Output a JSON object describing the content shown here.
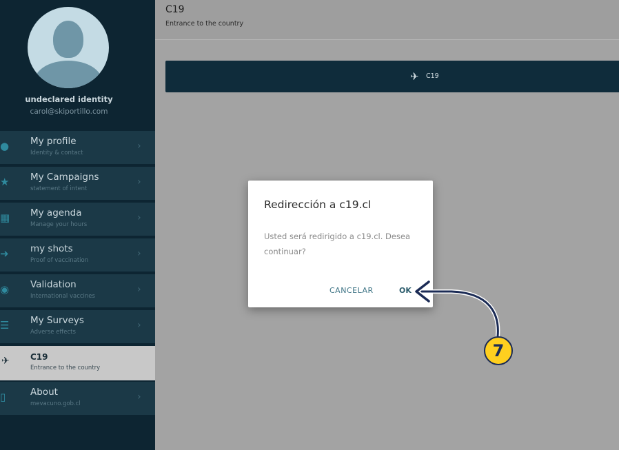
{
  "sidebar": {
    "user": {
      "name": "undeclared identity",
      "email": "carol@skiportillo.com"
    },
    "items": [
      {
        "title": "My profile",
        "subtitle": "Identity & contact",
        "icon": "person-icon"
      },
      {
        "title": "My Campaigns",
        "subtitle": "statement of intent",
        "icon": "star-icon"
      },
      {
        "title": "My agenda",
        "subtitle": "Manage your hours",
        "icon": "calendar-icon"
      },
      {
        "title": "my shots",
        "subtitle": "Proof of vaccination",
        "icon": "syringe-icon"
      },
      {
        "title": "Validation",
        "subtitle": "International vaccines",
        "icon": "globe-icon"
      },
      {
        "title": "My Surveys",
        "subtitle": "Adverse effects",
        "icon": "list-icon"
      },
      {
        "title": "C19",
        "subtitle": "Entrance to the country",
        "icon": "plane-landing-icon",
        "active": true
      },
      {
        "title": "About",
        "subtitle": "mevacuno.gob.cl",
        "icon": "phone-icon"
      }
    ]
  },
  "header": {
    "title": "C19",
    "subtitle": "Entrance to the country"
  },
  "c19_button": {
    "label": "C19",
    "icon": "plane-landing-icon"
  },
  "dialog": {
    "title": "Redirección a c19.cl",
    "message": "Usted será redirigido a c19.cl. Desea continuar?",
    "cancel_label": "CANCELAR",
    "ok_label": "OK"
  },
  "annotation": {
    "step": "7",
    "badge_color": "#ffcf1f",
    "arrow_color": "#1b2b55"
  }
}
